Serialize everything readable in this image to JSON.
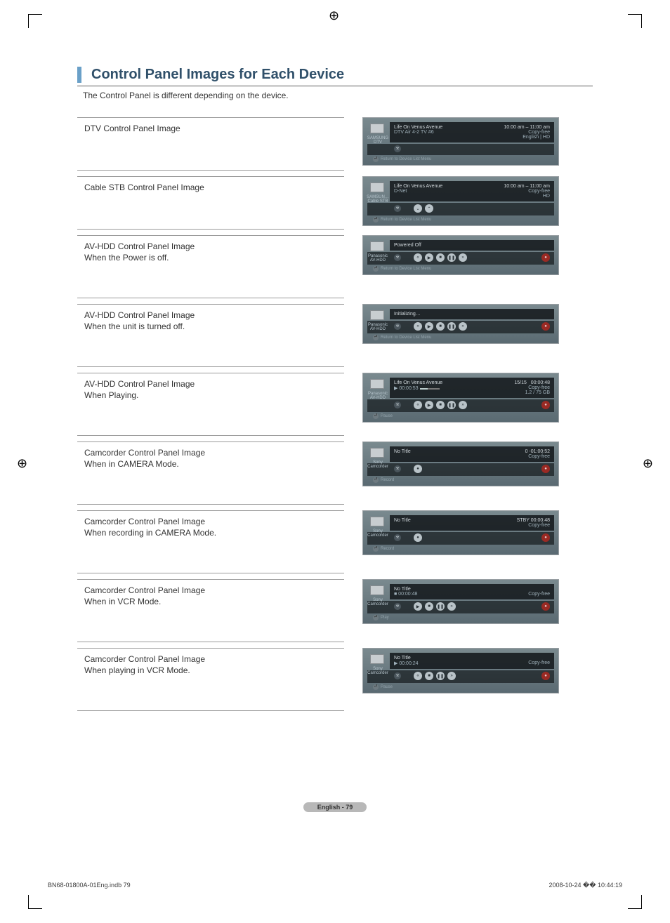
{
  "header": {
    "title": "Control Panel Images for Each Device",
    "intro": "The Control Panel is different depending on the device."
  },
  "rows": [
    {
      "label": "DTV Control Panel Image",
      "sub": "",
      "panel": {
        "device_brand": "SAMSUNG",
        "device_type": "DTV",
        "title": "Life On Venus Avenue",
        "subtitle": "DTV Air  4-2  TV #6",
        "right1": "10:00 am – 11:00 am",
        "right2": "Copy-free",
        "right3": "English | HD",
        "buttons": [
          "tools"
        ],
        "footer": "Return to Device List Menu"
      }
    },
    {
      "label": "Cable STB Control Panel Image",
      "sub": "",
      "panel": {
        "device_brand": "SAMSUN…",
        "device_type": "Cable STB",
        "title": "Life On Venus Avenue",
        "subtitle": "D-Net",
        "right1": "10:00 am – 11:00 am",
        "right2": "Copy-free",
        "right3": "HD",
        "buttons": [
          "tools",
          "ch-down",
          "ch-up"
        ],
        "footer": "Return to Device List Menu"
      }
    },
    {
      "label": "AV-HDD Control Panel Image",
      "sub": "When the Power is off.",
      "panel": {
        "device_brand": "Panasonic",
        "device_type": "AV-HDD",
        "title": "Powered Off",
        "subtitle": "",
        "right1": "",
        "right2": "",
        "right3": "",
        "buttons": [
          "tools",
          "rew",
          "play",
          "stop",
          "pause",
          "ff"
        ],
        "record": true,
        "footer": "Return to Device List Menu"
      }
    },
    {
      "label": "AV-HDD Control Panel Image",
      "sub": "When the unit is turned off.",
      "panel": {
        "device_brand": "Panasonic",
        "device_type": "AV-HDD",
        "title": "Initializing…",
        "subtitle": "",
        "right1": "",
        "right2": "",
        "right3": "",
        "buttons": [
          "tools",
          "rew",
          "play",
          "stop",
          "pause",
          "ff"
        ],
        "record": true,
        "footer": "Return to Device List Menu"
      }
    },
    {
      "label": "AV-HDD Control Panel Image",
      "sub": "When Playing.",
      "panel": {
        "device_brand": "Panasonic",
        "device_type": "AV-HDD",
        "title": "Life On Venus Avenue",
        "subtitle": "▶  00:00:53",
        "progress": true,
        "right_top": "15/15",
        "right1": "00:00:48",
        "right2": "Copy-free",
        "right3": "1.2 / 75 GB",
        "buttons": [
          "tools",
          "rew",
          "play",
          "stop",
          "pause",
          "ff"
        ],
        "record": true,
        "footer": "Pause"
      }
    },
    {
      "label": "Camcorder Control Panel Image",
      "sub": "When in CAMERA Mode.",
      "panel": {
        "device_brand": "Sony",
        "device_type": "Camcorder",
        "title": "No Title",
        "subtitle": "",
        "right1": "0  -01:00:52",
        "right2": "Copy-free",
        "right3": "",
        "buttons": [
          "tools",
          "rec"
        ],
        "record": true,
        "footer": "Record"
      }
    },
    {
      "label": "Camcorder Control Panel Image",
      "sub": "When recording in CAMERA Mode.",
      "panel": {
        "device_brand": "Sony",
        "device_type": "Camcorder",
        "title": "No Title",
        "subtitle": "",
        "right1": "STBY   00:00:48",
        "right2": "Copy-free",
        "right3": "",
        "buttons": [
          "tools",
          "rec-stop"
        ],
        "record": true,
        "footer": "Record"
      }
    },
    {
      "label": "Camcorder Control Panel Image",
      "sub": "When in VCR Mode.",
      "panel": {
        "device_brand": "Sony",
        "device_type": "Camcorder",
        "title": "No Title",
        "subtitle": "■  00:00:48",
        "right1": "",
        "right2": "Copy-free",
        "right3": "",
        "buttons": [
          "tools",
          "play",
          "stop",
          "pause",
          "ff"
        ],
        "record": true,
        "footer": "Play"
      }
    },
    {
      "label": "Camcorder Control Panel Image",
      "sub": "When playing in VCR Mode.",
      "panel": {
        "device_brand": "Sony",
        "device_type": "Camcorder",
        "title": "No Title",
        "subtitle": "▶  00:00:24",
        "right1": "",
        "right2": "Copy-free",
        "right3": "",
        "buttons": [
          "tools",
          "rew",
          "stop",
          "pause",
          "ff"
        ],
        "record": true,
        "footer": "Pause"
      }
    }
  ],
  "icon_glyph": {
    "tools": "⚒",
    "ch-down": "⌄",
    "ch-up": "⌃",
    "rew": "«",
    "play": "▶",
    "stop": "■",
    "pause": "❚❚",
    "ff": "»",
    "rec": "●",
    "rec-stop": "●"
  },
  "footer": {
    "page_label": "English - 79",
    "doc_id": "BN68-01800A-01Eng.indb   79",
    "timestamp": "2008-10-24   �� 10:44:19"
  }
}
